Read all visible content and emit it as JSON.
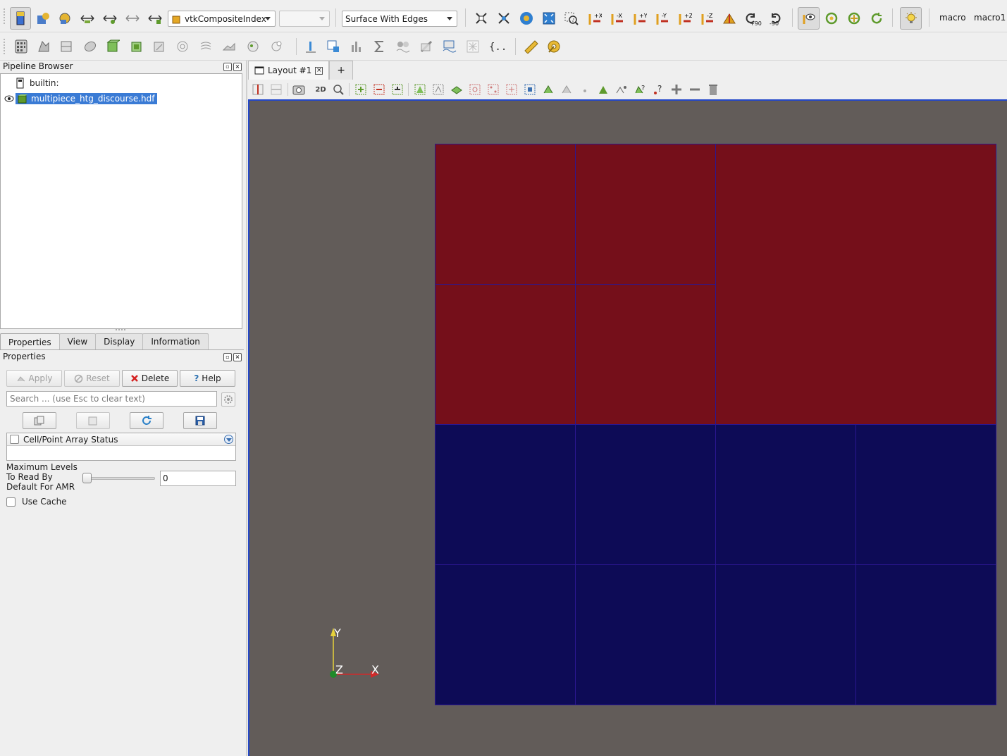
{
  "toolbar": {
    "composite_index_combo": "vtkCompositeIndex",
    "empty_combo": "",
    "representation_combo": "Surface With Edges",
    "rotate_plus90_label": "+90",
    "rotate_minus90_label": "-90",
    "macro_1": "macro",
    "macro_2": "macro1"
  },
  "pipeline_browser": {
    "title": "Pipeline Browser",
    "items": [
      {
        "label": "builtin:"
      },
      {
        "label": "multipiece_htg_discourse.hdf"
      }
    ]
  },
  "tabs": [
    {
      "label": "Properties"
    },
    {
      "label": "View"
    },
    {
      "label": "Display"
    },
    {
      "label": "Information"
    }
  ],
  "properties": {
    "title": "Properties",
    "apply": "Apply",
    "reset": "Reset",
    "delete": "Delete",
    "help": "Help",
    "search_placeholder": "Search ... (use Esc to clear text)",
    "array_status_header": "Cell/Point Array Status",
    "max_levels_label_1": "Maximum Levels",
    "max_levels_label_2": "To Read By",
    "max_levels_label_3": "Default For AMR",
    "max_levels_value": "0",
    "use_cache": "Use Cache"
  },
  "layout": {
    "tab_label": "Layout #1",
    "add_tab": "+",
    "mode_2d": "2D"
  },
  "axes": {
    "y": "Y",
    "z": "Z",
    "x": "X"
  },
  "colors": {
    "red_cells": "#750f1a",
    "blue_cells": "#0d0b56",
    "background": "#625c59",
    "selection": "#3a7bd5",
    "viewport_border": "#2347c9"
  }
}
